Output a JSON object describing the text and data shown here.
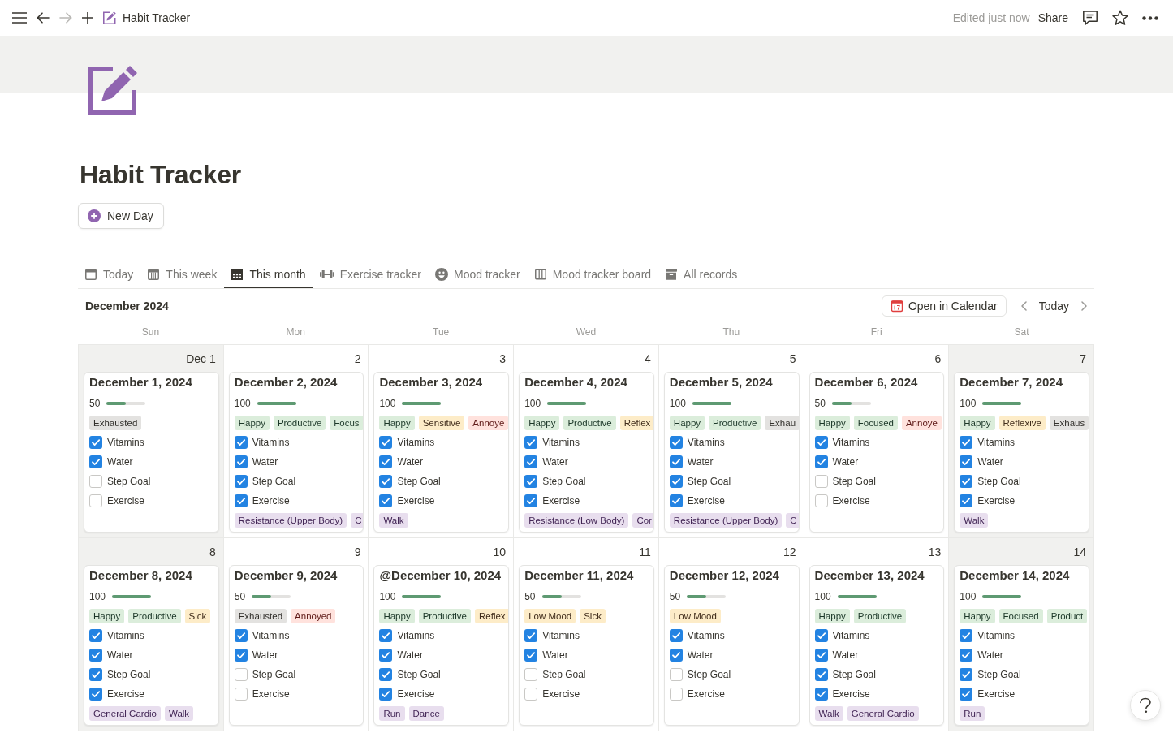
{
  "topbar": {
    "navigation": {
      "back": {
        "disabled": false
      },
      "forward": {
        "disabled": true
      }
    },
    "breadcrumb": "Habit Tracker",
    "status": "Edited just now",
    "share": "Share"
  },
  "page": {
    "title": "Habit Tracker",
    "new_button": "New Day"
  },
  "tabs": [
    {
      "label": "Today",
      "kind": "calendar",
      "selected": false
    },
    {
      "label": "This week",
      "kind": "week",
      "selected": false
    },
    {
      "label": "This month",
      "kind": "month",
      "selected": true
    },
    {
      "label": "Exercise tracker",
      "kind": "dumbbell",
      "selected": false
    },
    {
      "label": "Mood tracker",
      "kind": "smiley",
      "selected": false
    },
    {
      "label": "Mood tracker board",
      "kind": "board",
      "selected": false
    },
    {
      "label": "All records",
      "kind": "archive",
      "selected": false
    }
  ],
  "calendar": {
    "month": "December 2024",
    "open_button": "Open in Calendar",
    "today_button": "Today",
    "weekdays": [
      "Sun",
      "Mon",
      "Tue",
      "Wed",
      "Thu",
      "Fri",
      "Sat"
    ],
    "weeks": [
      [
        {
          "day": "Dec 1",
          "weekend": true,
          "entry": {
            "title": "December 1, 2024",
            "score": "50",
            "level": 0.5,
            "moods": [
              {
                "label": "Exhausted",
                "color": "#e3e2e0"
              }
            ],
            "habits": [
              {
                "label": "Vitamins",
                "checked": true
              },
              {
                "label": "Water",
                "checked": true
              },
              {
                "label": "Step Goal",
                "checked": false
              },
              {
                "label": "Exercise",
                "checked": false
              }
            ]
          }
        },
        {
          "day": "2",
          "weekend": false,
          "entry": {
            "title": "December 2, 2024",
            "score": "100",
            "level": 1,
            "moods": [
              {
                "label": "Happy",
                "color": "#dbeddb"
              },
              {
                "label": "Productive",
                "color": "#dbeddb"
              },
              {
                "label": "Focus",
                "color": "#dbeddb"
              }
            ],
            "habits": [
              {
                "label": "Vitamins",
                "checked": true
              },
              {
                "label": "Water",
                "checked": true
              },
              {
                "label": "Step Goal",
                "checked": true
              },
              {
                "label": "Exercise",
                "checked": true
              }
            ],
            "exercises": [
              "Resistance (Upper Body)",
              "C"
            ]
          }
        },
        {
          "day": "3",
          "weekend": false,
          "entry": {
            "title": "December 3, 2024",
            "score": "100",
            "level": 1,
            "moods": [
              {
                "label": "Happy",
                "color": "#dbeddb"
              },
              {
                "label": "Sensitive",
                "color": "#fdecc8"
              },
              {
                "label": "Annoye",
                "color": "#ffe2dd"
              }
            ],
            "habits": [
              {
                "label": "Vitamins",
                "checked": true
              },
              {
                "label": "Water",
                "checked": true
              },
              {
                "label": "Step Goal",
                "checked": true
              },
              {
                "label": "Exercise",
                "checked": true
              }
            ],
            "exercises": [
              "Walk"
            ]
          }
        },
        {
          "day": "4",
          "weekend": false,
          "entry": {
            "title": "December 4, 2024",
            "score": "100",
            "level": 1,
            "moods": [
              {
                "label": "Happy",
                "color": "#dbeddb"
              },
              {
                "label": "Productive",
                "color": "#dbeddb"
              },
              {
                "label": "Reflex",
                "color": "#fdecc8"
              }
            ],
            "habits": [
              {
                "label": "Vitamins",
                "checked": true
              },
              {
                "label": "Water",
                "checked": true
              },
              {
                "label": "Step Goal",
                "checked": true
              },
              {
                "label": "Exercise",
                "checked": true
              }
            ],
            "exercises": [
              "Resistance (Low Body)",
              "Cor"
            ]
          }
        },
        {
          "day": "5",
          "weekend": false,
          "entry": {
            "title": "December 5, 2024",
            "score": "100",
            "level": 1,
            "moods": [
              {
                "label": "Happy",
                "color": "#dbeddb"
              },
              {
                "label": "Productive",
                "color": "#dbeddb"
              },
              {
                "label": "Exhau",
                "color": "#e3e2e0"
              }
            ],
            "habits": [
              {
                "label": "Vitamins",
                "checked": true
              },
              {
                "label": "Water",
                "checked": true
              },
              {
                "label": "Step Goal",
                "checked": true
              },
              {
                "label": "Exercise",
                "checked": true
              }
            ],
            "exercises": [
              "Resistance (Upper Body)",
              "C"
            ]
          }
        },
        {
          "day": "6",
          "weekend": false,
          "entry": {
            "title": "December 6, 2024",
            "score": "50",
            "level": 0.5,
            "moods": [
              {
                "label": "Happy",
                "color": "#dbeddb"
              },
              {
                "label": "Focused",
                "color": "#dbeddb"
              },
              {
                "label": "Annoye",
                "color": "#ffe2dd"
              }
            ],
            "habits": [
              {
                "label": "Vitamins",
                "checked": true
              },
              {
                "label": "Water",
                "checked": true
              },
              {
                "label": "Step Goal",
                "checked": false
              },
              {
                "label": "Exercise",
                "checked": false
              }
            ]
          }
        },
        {
          "day": "7",
          "weekend": true,
          "entry": {
            "title": "December 7, 2024",
            "score": "100",
            "level": 1,
            "moods": [
              {
                "label": "Happy",
                "color": "#dbeddb"
              },
              {
                "label": "Reflexive",
                "color": "#fdecc8"
              },
              {
                "label": "Exhaus",
                "color": "#e3e2e0"
              }
            ],
            "habits": [
              {
                "label": "Vitamins",
                "checked": true
              },
              {
                "label": "Water",
                "checked": true
              },
              {
                "label": "Step Goal",
                "checked": true
              },
              {
                "label": "Exercise",
                "checked": true
              }
            ],
            "exercises": [
              "Walk"
            ]
          }
        }
      ],
      [
        {
          "day": "8",
          "weekend": true,
          "entry": {
            "title": "December 8, 2024",
            "score": "100",
            "level": 1,
            "moods": [
              {
                "label": "Happy",
                "color": "#dbeddb"
              },
              {
                "label": "Productive",
                "color": "#dbeddb"
              },
              {
                "label": "Sick",
                "color": "#fdecc8"
              }
            ],
            "habits": [
              {
                "label": "Vitamins",
                "checked": true
              },
              {
                "label": "Water",
                "checked": true
              },
              {
                "label": "Step Goal",
                "checked": true
              },
              {
                "label": "Exercise",
                "checked": true
              }
            ],
            "exercises": [
              "General Cardio",
              "Walk"
            ]
          }
        },
        {
          "day": "9",
          "weekend": false,
          "entry": {
            "title": "December 9, 2024",
            "score": "50",
            "level": 0.5,
            "moods": [
              {
                "label": "Exhausted",
                "color": "#e3e2e0"
              },
              {
                "label": "Annoyed",
                "color": "#ffe2dd"
              }
            ],
            "habits": [
              {
                "label": "Vitamins",
                "checked": true
              },
              {
                "label": "Water",
                "checked": true
              },
              {
                "label": "Step Goal",
                "checked": false
              },
              {
                "label": "Exercise",
                "checked": false
              }
            ]
          }
        },
        {
          "day": "10",
          "weekend": false,
          "entry": {
            "title": "@December 10, 2024",
            "score": "100",
            "level": 1,
            "moods": [
              {
                "label": "Happy",
                "color": "#dbeddb"
              },
              {
                "label": "Productive",
                "color": "#dbeddb"
              },
              {
                "label": "Reflex",
                "color": "#fdecc8"
              }
            ],
            "habits": [
              {
                "label": "Vitamins",
                "checked": true
              },
              {
                "label": "Water",
                "checked": true
              },
              {
                "label": "Step Goal",
                "checked": true
              },
              {
                "label": "Exercise",
                "checked": true
              }
            ],
            "exercises": [
              "Run",
              "Dance"
            ]
          }
        },
        {
          "day": "11",
          "weekend": false,
          "entry": {
            "title": "December 11, 2024",
            "score": "50",
            "level": 0.5,
            "moods": [
              {
                "label": "Low Mood",
                "color": "#fdecc8"
              },
              {
                "label": "Sick",
                "color": "#fdecc8"
              }
            ],
            "habits": [
              {
                "label": "Vitamins",
                "checked": true
              },
              {
                "label": "Water",
                "checked": true
              },
              {
                "label": "Step Goal",
                "checked": false
              },
              {
                "label": "Exercise",
                "checked": false
              }
            ]
          }
        },
        {
          "day": "12",
          "weekend": false,
          "entry": {
            "title": "December 12, 2024",
            "score": "50",
            "level": 0.5,
            "moods": [
              {
                "label": "Low Mood",
                "color": "#fdecc8"
              }
            ],
            "habits": [
              {
                "label": "Vitamins",
                "checked": true
              },
              {
                "label": "Water",
                "checked": true
              },
              {
                "label": "Step Goal",
                "checked": false
              },
              {
                "label": "Exercise",
                "checked": false
              }
            ]
          }
        },
        {
          "day": "13",
          "weekend": false,
          "entry": {
            "title": "December 13, 2024",
            "score": "100",
            "level": 1,
            "moods": [
              {
                "label": "Happy",
                "color": "#dbeddb"
              },
              {
                "label": "Productive",
                "color": "#dbeddb"
              }
            ],
            "habits": [
              {
                "label": "Vitamins",
                "checked": true
              },
              {
                "label": "Water",
                "checked": true
              },
              {
                "label": "Step Goal",
                "checked": true
              },
              {
                "label": "Exercise",
                "checked": true
              }
            ],
            "exercises": [
              "Walk",
              "General Cardio"
            ]
          }
        },
        {
          "day": "14",
          "weekend": true,
          "entry": {
            "title": "December 14, 2024",
            "score": "100",
            "level": 1,
            "moods": [
              {
                "label": "Happy",
                "color": "#dbeddb"
              },
              {
                "label": "Focused",
                "color": "#dbeddb"
              },
              {
                "label": "Product",
                "color": "#dbeddb"
              }
            ],
            "habits": [
              {
                "label": "Vitamins",
                "checked": true
              },
              {
                "label": "Water",
                "checked": true
              },
              {
                "label": "Step Goal",
                "checked": true
              },
              {
                "label": "Exercise",
                "checked": true
              }
            ],
            "exercises": [
              "Run"
            ]
          }
        }
      ]
    ]
  }
}
